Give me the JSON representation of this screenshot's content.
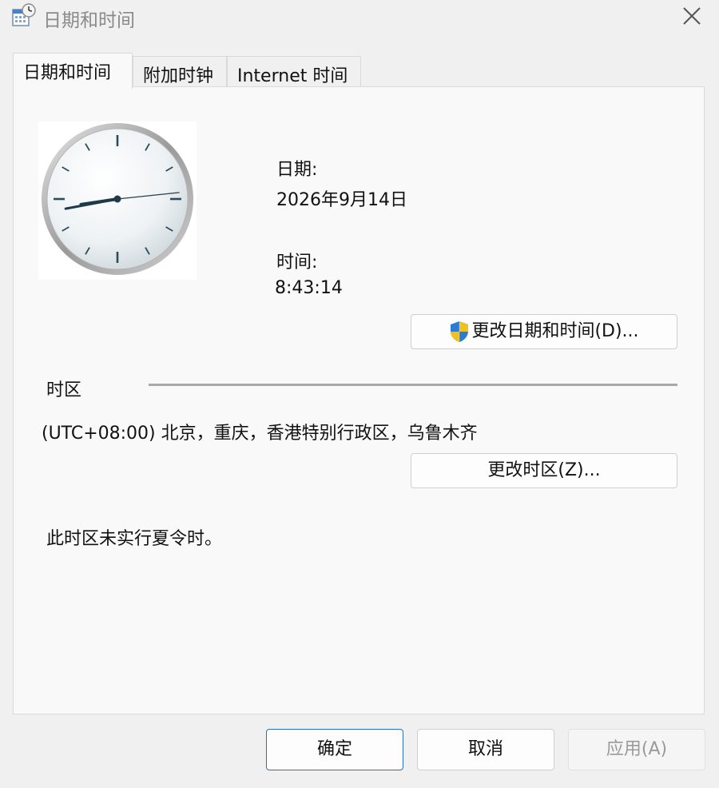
{
  "window": {
    "title": "日期和时间",
    "title_icon": "calendar-clock-icon",
    "close_icon": "close-icon"
  },
  "tabs": [
    {
      "label": "日期和时间",
      "active": true
    },
    {
      "label": "附加时钟",
      "active": false
    },
    {
      "label": "Internet 时间",
      "active": false
    }
  ],
  "datetime": {
    "date_label": "日期:",
    "date_value": "2026年9月14日",
    "time_label": "时间:",
    "time_value": "8:43:14",
    "change_button_label": "更改日期和时间(D)...",
    "change_button_icon": "uac-shield-icon"
  },
  "clock": {
    "hour": 8,
    "minute": 43,
    "second": 14
  },
  "timezone": {
    "section_label": "时区",
    "value": "(UTC+08:00) 北京，重庆，香港特别行政区，乌鲁木齐",
    "change_button_label": "更改时区(Z)...",
    "dst_note": "此时区未实行夏令时。"
  },
  "footer": {
    "ok_label": "确定",
    "cancel_label": "取消",
    "apply_label": "应用(A)"
  },
  "colors": {
    "dialog_bg": "#f0f0f0",
    "panel_bg": "#f9f9f9",
    "primary_border": "#2f6fb5",
    "disabled_text": "#9a9a9a"
  }
}
